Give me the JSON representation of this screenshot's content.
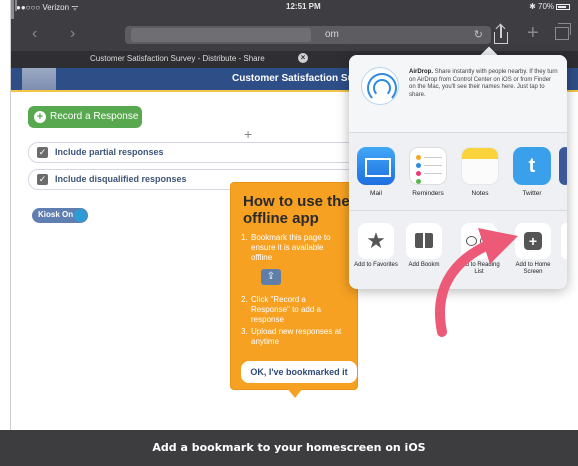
{
  "status_bar": {
    "carrier": "●●○○○ Verizon ᯤ",
    "time": "12:51 PM",
    "battery": "✱ 70%"
  },
  "browser": {
    "url_text": "om",
    "tab_title": "Customer Satisfaction Survey - Distribute - Share"
  },
  "page": {
    "title": "Customer Satisfaction Surve",
    "record_button": "Record a Response",
    "options": [
      {
        "label": "Include partial responses",
        "checked": true
      },
      {
        "label": "Include disqualified responses",
        "checked": true
      }
    ],
    "kiosk_label": "Kiosk On"
  },
  "help_card": {
    "title": "How to use the offline app",
    "steps": [
      {
        "num": "1.",
        "text": "Bookmark this page to ensure it is available offline"
      },
      {
        "num": "2.",
        "text": "Click \"Record a Response\" to add a response"
      },
      {
        "num": "3.",
        "text": "Upload new responses at anytime"
      }
    ],
    "button": "OK, I've bookmarked it"
  },
  "share_sheet": {
    "airdrop_name": "AirDrop.",
    "airdrop_text": "Share instantly with people nearby. If they turn on AirDrop from Control Center on iOS or from Finder on the Mac, you'll see their names here. Just tap to share.",
    "apps": [
      {
        "label": "Mail",
        "icon": "mail-icon"
      },
      {
        "label": "Reminders",
        "icon": "reminders-icon"
      },
      {
        "label": "Notes",
        "icon": "notes-icon"
      },
      {
        "label": "Twitter",
        "icon": "twitter-icon"
      }
    ],
    "actions": [
      {
        "label": "Add to Favorites",
        "icon": "star-icon"
      },
      {
        "label": "Add Bookm",
        "icon": "book-icon"
      },
      {
        "label": "Add to Reading List",
        "icon": "glasses-icon"
      },
      {
        "label": "Add to Home Screen",
        "icon": "add-home-icon"
      }
    ]
  },
  "caption": "Add a bookmark to your homescreen on iOS",
  "colors": {
    "header": "#2d4e87",
    "accent_orange": "#f7a123",
    "record_green": "#58a84f",
    "arrow_pink": "#ec5a78",
    "caption_bg": "#3d3d3f"
  }
}
